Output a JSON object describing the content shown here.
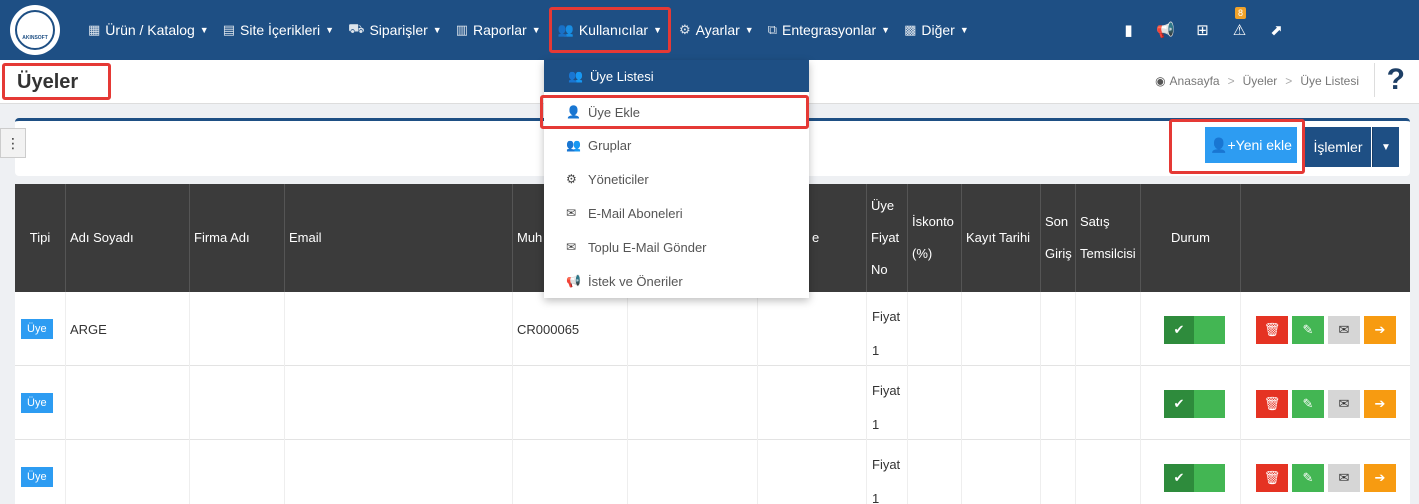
{
  "brand": {
    "logo_text": "AKINSOFT"
  },
  "nav": {
    "items": [
      {
        "label": "Ürün / Katalog",
        "icon": "products-icon"
      },
      {
        "label": "Site İçerikleri",
        "icon": "content-icon"
      },
      {
        "label": "Siparişler",
        "icon": "orders-icon"
      },
      {
        "label": "Raporlar",
        "icon": "reports-icon"
      },
      {
        "label": "Kullanıcılar",
        "icon": "users-icon"
      },
      {
        "label": "Ayarlar",
        "icon": "settings-icon"
      },
      {
        "label": "Entegrasyonlar",
        "icon": "integrations-icon"
      },
      {
        "label": "Diğer",
        "icon": "other-icon"
      }
    ],
    "alert_count": "8"
  },
  "page": {
    "title": "Üyeler",
    "breadcrumb": [
      "Anasayfa",
      "Üyeler",
      "Üye Listesi"
    ],
    "help": "?"
  },
  "toolbar": {
    "new_label": "Yeni ekle",
    "ops_label": "İşlemler"
  },
  "dropdown": {
    "items": [
      {
        "label": "Üye Listesi",
        "icon": "users-icon"
      },
      {
        "label": "Üye Ekle",
        "icon": "user-plus-icon"
      },
      {
        "label": "Gruplar",
        "icon": "groups-icon"
      },
      {
        "label": "Yöneticiler",
        "icon": "admins-icon"
      },
      {
        "label": "E-Mail Aboneleri",
        "icon": "envelope-icon"
      },
      {
        "label": "Toplu E-Mail Gönder",
        "icon": "bulk-mail-icon"
      },
      {
        "label": "İstek ve Öneriler",
        "icon": "megaphone-icon"
      }
    ]
  },
  "table": {
    "headers": {
      "tipi": "Tipi",
      "adi": "Adı Soyadı",
      "firma": "Firma Adı",
      "email": "Email",
      "muh": "Muh",
      "col6": "",
      "col7": "e",
      "fiyat_1": "Üye",
      "fiyat_2": "Fiyat",
      "fiyat_3": "No",
      "iskonto_1": "İskonto",
      "iskonto_2": "(%)",
      "kayit": "Kayıt Tarihi",
      "son_1": "Son",
      "son_2": "Giriş",
      "satis_1": "Satış",
      "satis_2": "Temsilcisi",
      "durum": "Durum"
    },
    "rows": [
      {
        "tipi": "Üye",
        "adi": "ARGE",
        "muh": "CR000065",
        "fiyat_1": "Fiyat",
        "fiyat_2": "1"
      },
      {
        "tipi": "Üye",
        "adi": "",
        "muh": "",
        "fiyat_1": "Fiyat",
        "fiyat_2": "1"
      },
      {
        "tipi": "Üye",
        "adi": "",
        "muh": "",
        "fiyat_1": "Fiyat",
        "fiyat_2": "1"
      }
    ]
  }
}
